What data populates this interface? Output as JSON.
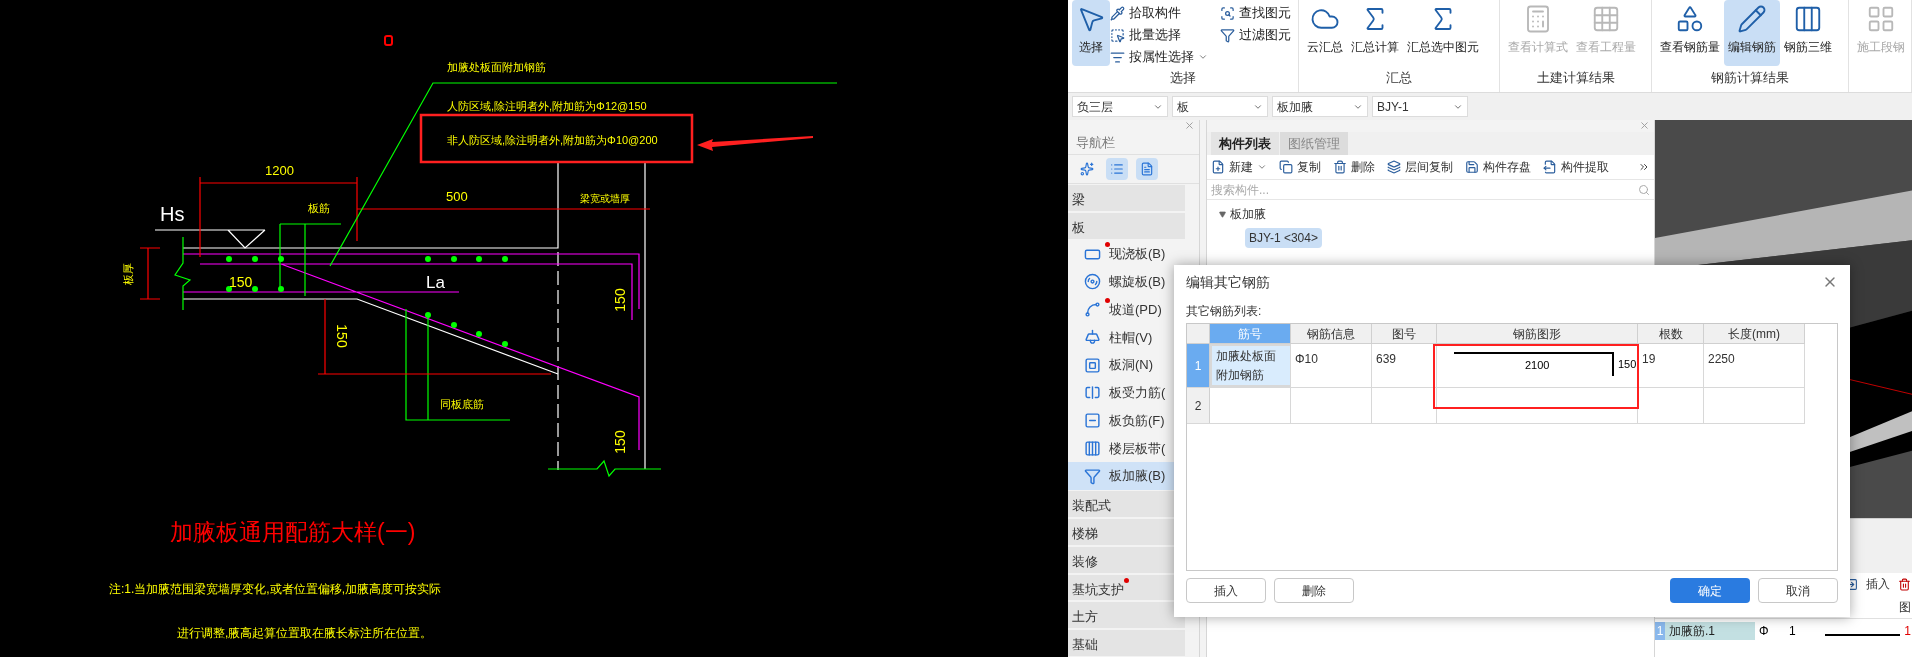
{
  "cad": {
    "labels": [
      "加腋处板面附加钢筋",
      "人防区域,除注明者外,附加筋为Φ12@150",
      "非人防区域,除注明者外,附加筋为Φ10@200",
      "1200",
      "500",
      "梁宽或墙厚",
      "Hs",
      "板筋",
      "板厚",
      "150",
      "La",
      "150",
      "150",
      "同板底筋",
      "150"
    ],
    "title": "加腋板通用配筋大样(一)",
    "notes": [
      "注:1.当加腋范围梁宽墙厚变化,或者位置偏移,加腋高度可按实际",
      "进行调整,腋高起算位置取在腋长标注所在位置。"
    ]
  },
  "ribbon": {
    "groups": [
      {
        "label": "选择",
        "items": [
          {
            "label": "选择",
            "kind": "large",
            "selected": true,
            "disabled": false
          },
          {
            "label": "拾取构件",
            "kind": "small",
            "selected": false,
            "disabled": false
          },
          {
            "label": "批量选择",
            "kind": "small",
            "selected": false,
            "disabled": false
          },
          {
            "label": "按属性选择",
            "kind": "dropdown",
            "selected": false,
            "disabled": false
          },
          {
            "label": "查找图元",
            "kind": "small",
            "selected": false,
            "disabled": false
          },
          {
            "label": "过滤图元",
            "kind": "small",
            "selected": false,
            "disabled": false
          }
        ]
      },
      {
        "label": "汇总",
        "items": [
          {
            "label": "云汇总",
            "kind": "large",
            "selected": false,
            "disabled": false
          },
          {
            "label": "汇总计算",
            "kind": "large",
            "selected": false,
            "disabled": false
          },
          {
            "label": "汇总选中图元",
            "kind": "large",
            "selected": false,
            "disabled": false
          }
        ]
      },
      {
        "label": "土建计算结果",
        "items": [
          {
            "label": "查看计算式",
            "kind": "large",
            "selected": false,
            "disabled": true
          },
          {
            "label": "查看工程量",
            "kind": "large",
            "selected": false,
            "disabled": true
          }
        ]
      },
      {
        "label": "钢筋计算结果",
        "items": [
          {
            "label": "查看钢筋量",
            "kind": "large",
            "selected": false,
            "disabled": false
          },
          {
            "label": "编辑钢筋",
            "kind": "large",
            "selected": true,
            "disabled": false
          },
          {
            "label": "钢筋三维",
            "kind": "large",
            "selected": false,
            "disabled": false
          }
        ]
      },
      {
        "items": [
          {
            "label": "施工段钢",
            "kind": "large",
            "selected": false,
            "disabled": true
          }
        ]
      }
    ]
  },
  "selectors": [
    "负三层",
    "板",
    "板加腋",
    "BJY-1"
  ],
  "nav_panel": {
    "title": "导航栏",
    "view_buttons": [
      {
        "selected": false
      },
      {
        "selected": true
      },
      {
        "selected": true
      }
    ],
    "categories": [
      {
        "label": "梁",
        "dot": false
      },
      {
        "label": "板",
        "dot": false,
        "items": [
          {
            "label": "现浇板(B)",
            "dot": true,
            "selected": false
          },
          {
            "label": "螺旋板(B)",
            "dot": false,
            "selected": false
          },
          {
            "label": "坡道(PD)",
            "dot": true,
            "selected": false
          },
          {
            "label": "柱帽(V)",
            "dot": false,
            "selected": false
          },
          {
            "label": "板洞(N)",
            "dot": false,
            "selected": false
          },
          {
            "label": "板受力筋(",
            "dot": false,
            "selected": false
          },
          {
            "label": "板负筋(F)",
            "dot": false,
            "selected": false
          },
          {
            "label": "楼层板带(",
            "dot": false,
            "selected": false
          },
          {
            "label": "板加腋(B)",
            "dot": false,
            "selected": true
          }
        ]
      },
      {
        "label": "装配式",
        "dot": false
      },
      {
        "label": "楼梯",
        "dot": false
      },
      {
        "label": "装修",
        "dot": false
      },
      {
        "label": "基坑支护",
        "dot": true
      },
      {
        "label": "土方",
        "dot": false
      },
      {
        "label": "基础",
        "dot": false
      }
    ]
  },
  "component_panel": {
    "tabs": [
      {
        "label": "构件列表",
        "selected": true
      },
      {
        "label": "图纸管理",
        "selected": false
      }
    ],
    "toolbar": [
      {
        "label": "新建",
        "menu": true
      },
      {
        "label": "复制",
        "menu": false
      },
      {
        "label": "删除",
        "menu": false
      },
      {
        "label": "层间复制",
        "menu": false
      },
      {
        "label": "构件存盘",
        "menu": false
      },
      {
        "label": "构件提取",
        "menu": false
      }
    ],
    "search": {
      "placeholder": "搜索构件..."
    },
    "tree": [
      {
        "label": "板加腋",
        "expanded": true,
        "selected": false,
        "children": [
          {
            "label": "BJY-1 <304>",
            "selected": true
          }
        ]
      }
    ]
  },
  "dialog": {
    "title": "编辑其它钢筋",
    "list_label": "其它钢筋列表:",
    "columns": [
      {
        "label": "筋号",
        "selected": true
      },
      {
        "label": "钢筋信息",
        "selected": false
      },
      {
        "label": "图号",
        "selected": false
      },
      {
        "label": "钢筋图形",
        "selected": false
      },
      {
        "label": "根数",
        "selected": false
      },
      {
        "label": "长度(mm)",
        "selected": false
      }
    ],
    "rows": [
      {
        "number": "1",
        "selected": true,
        "bar_name": "加腋处板面附加钢筋",
        "bar_info": "Φ10",
        "shape_no": "639",
        "shape": {
          "length": "2100",
          "hook": "150"
        },
        "count": "19",
        "length": "2250"
      },
      {
        "number": "2",
        "selected": false
      }
    ],
    "left_buttons": [
      {
        "label": "插入",
        "primary": false
      },
      {
        "label": "删除",
        "primary": false
      }
    ],
    "right_buttons": [
      {
        "label": "确定",
        "primary": true
      },
      {
        "label": "取消",
        "primary": false
      }
    ]
  },
  "bottom_panel": {
    "toolbar": [
      "插入"
    ],
    "column_header": "图",
    "row": {
      "number": "1",
      "name": "加腋筋.1",
      "grade": "Φ",
      "count": "1",
      "mark": "1"
    }
  }
}
